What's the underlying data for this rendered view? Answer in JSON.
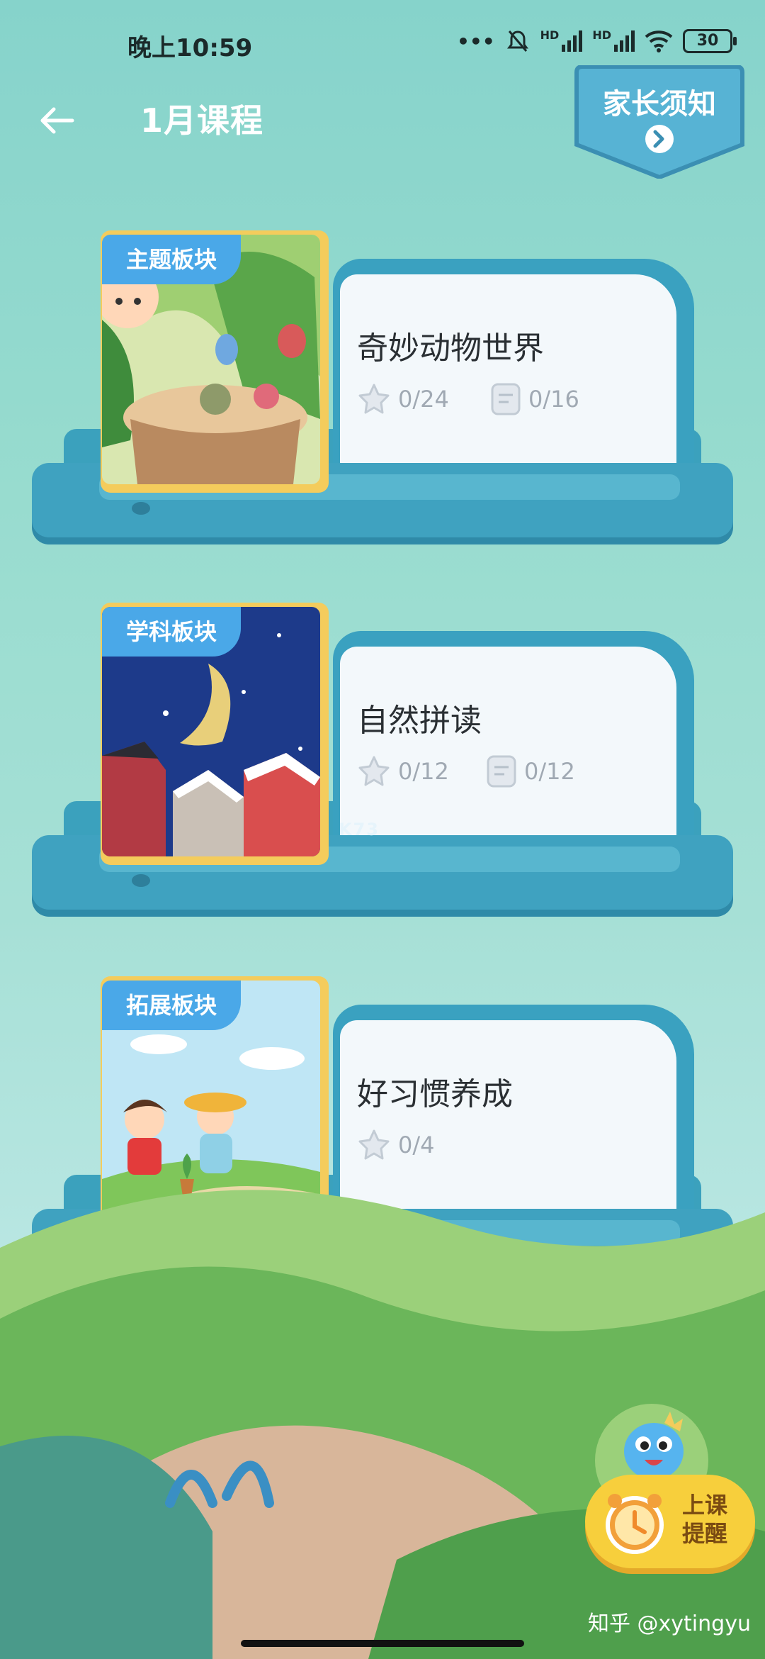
{
  "status_bar": {
    "time": "晚上10:59",
    "battery": "30",
    "network_1": "HD",
    "network_2": "HD"
  },
  "header": {
    "title": "1月课程",
    "back_icon": "arrow-left-icon"
  },
  "parent_notice": {
    "label": "家长须知",
    "icon": "chevron-right-icon"
  },
  "courses": [
    {
      "tag": "主题板块",
      "title": "奇妙动物世界",
      "stars": "0/24",
      "docs": "0/16"
    },
    {
      "tag": "学科板块",
      "title": "自然拼读",
      "stars": "0/12",
      "docs": "0/12"
    },
    {
      "tag": "拓展板块",
      "title": "好习惯养成",
      "stars": "0/4"
    }
  ],
  "reminder": {
    "line1": "上课",
    "line2": "提醒"
  },
  "watermark": "知乎 @xytingyu",
  "site_mark": "K73"
}
